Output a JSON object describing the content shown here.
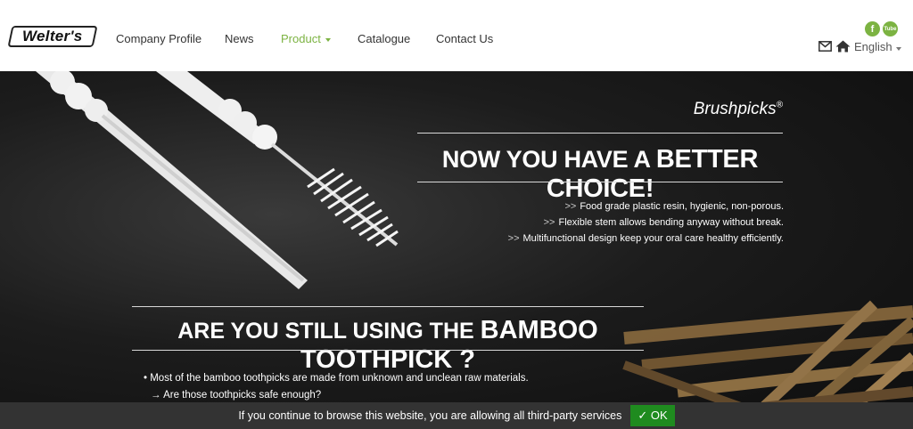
{
  "header": {
    "logo_text": "Welter's",
    "nav": [
      {
        "label": "Company Profile"
      },
      {
        "label": "News"
      },
      {
        "label": "Product"
      },
      {
        "label": "Catalogue"
      },
      {
        "label": "Contact Us"
      }
    ],
    "active_nav": "Product",
    "social": [
      {
        "icon": "facebook-icon",
        "glyph": "f"
      },
      {
        "icon": "youtube-icon",
        "glyph": "Tube"
      }
    ],
    "utility": {
      "mail_icon": "envelope-icon",
      "home_icon": "home-icon",
      "language": "English"
    }
  },
  "hero": {
    "brand": "Brushpicks",
    "brand_mark": "®",
    "headline1_prefix": "NOW YOU HAVE A ",
    "headline1_emph": "BETTER CHOICE!",
    "bullet_marker": ">>",
    "bullets": [
      "Food grade plastic resin, hygienic, non-porous.",
      "Flexible stem allows bending anyway without break.",
      "Multifunctional design keep your oral care healthy efficiently."
    ],
    "headline2_prefix": "ARE YOU STILL USING THE ",
    "headline2_emph": "BAMBOO TOOTHPICK ?",
    "sub_bullet": "• Most of the bamboo toothpicks are made from unknown and unclean raw materials.",
    "sub_arrow": "→",
    "sub_question": "Are those toothpicks safe enough?"
  },
  "cookie": {
    "message": "If you continue to browse this website, you are allowing all third-party services",
    "ok_label": "✓ OK"
  },
  "colors": {
    "accent": "#7cb342",
    "cookie_bg": "#333333",
    "ok_bg": "#1f8b1f"
  }
}
